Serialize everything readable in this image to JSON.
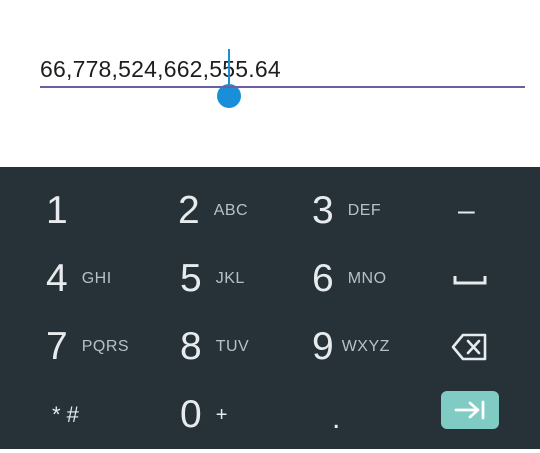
{
  "input": {
    "value": "66,778,524,662,555.64"
  },
  "keyboard": {
    "keys": [
      {
        "digit": "1",
        "letters": ""
      },
      {
        "digit": "2",
        "letters": "ABC"
      },
      {
        "digit": "3",
        "letters": "DEF"
      },
      {
        "digit": "4",
        "letters": "GHI"
      },
      {
        "digit": "5",
        "letters": "JKL"
      },
      {
        "digit": "6",
        "letters": "MNO"
      },
      {
        "digit": "7",
        "letters": "PQRS"
      },
      {
        "digit": "8",
        "letters": "TUV"
      },
      {
        "digit": "9",
        "letters": "WXYZ"
      },
      {
        "digit": "0",
        "letters": "+"
      }
    ],
    "symbols_key": "* #",
    "minus_key": "–",
    "period_key": ".",
    "icons": {
      "space": "space-icon",
      "backspace": "backspace-icon",
      "next": "next-arrow-icon"
    },
    "colors": {
      "background": "#263238",
      "key_text": "#e7ebed",
      "letters_text": "#b8c0c4",
      "action_key": "#80cbc4",
      "cursor": "#1a8fd9",
      "underline": "#6a5fa0"
    }
  }
}
